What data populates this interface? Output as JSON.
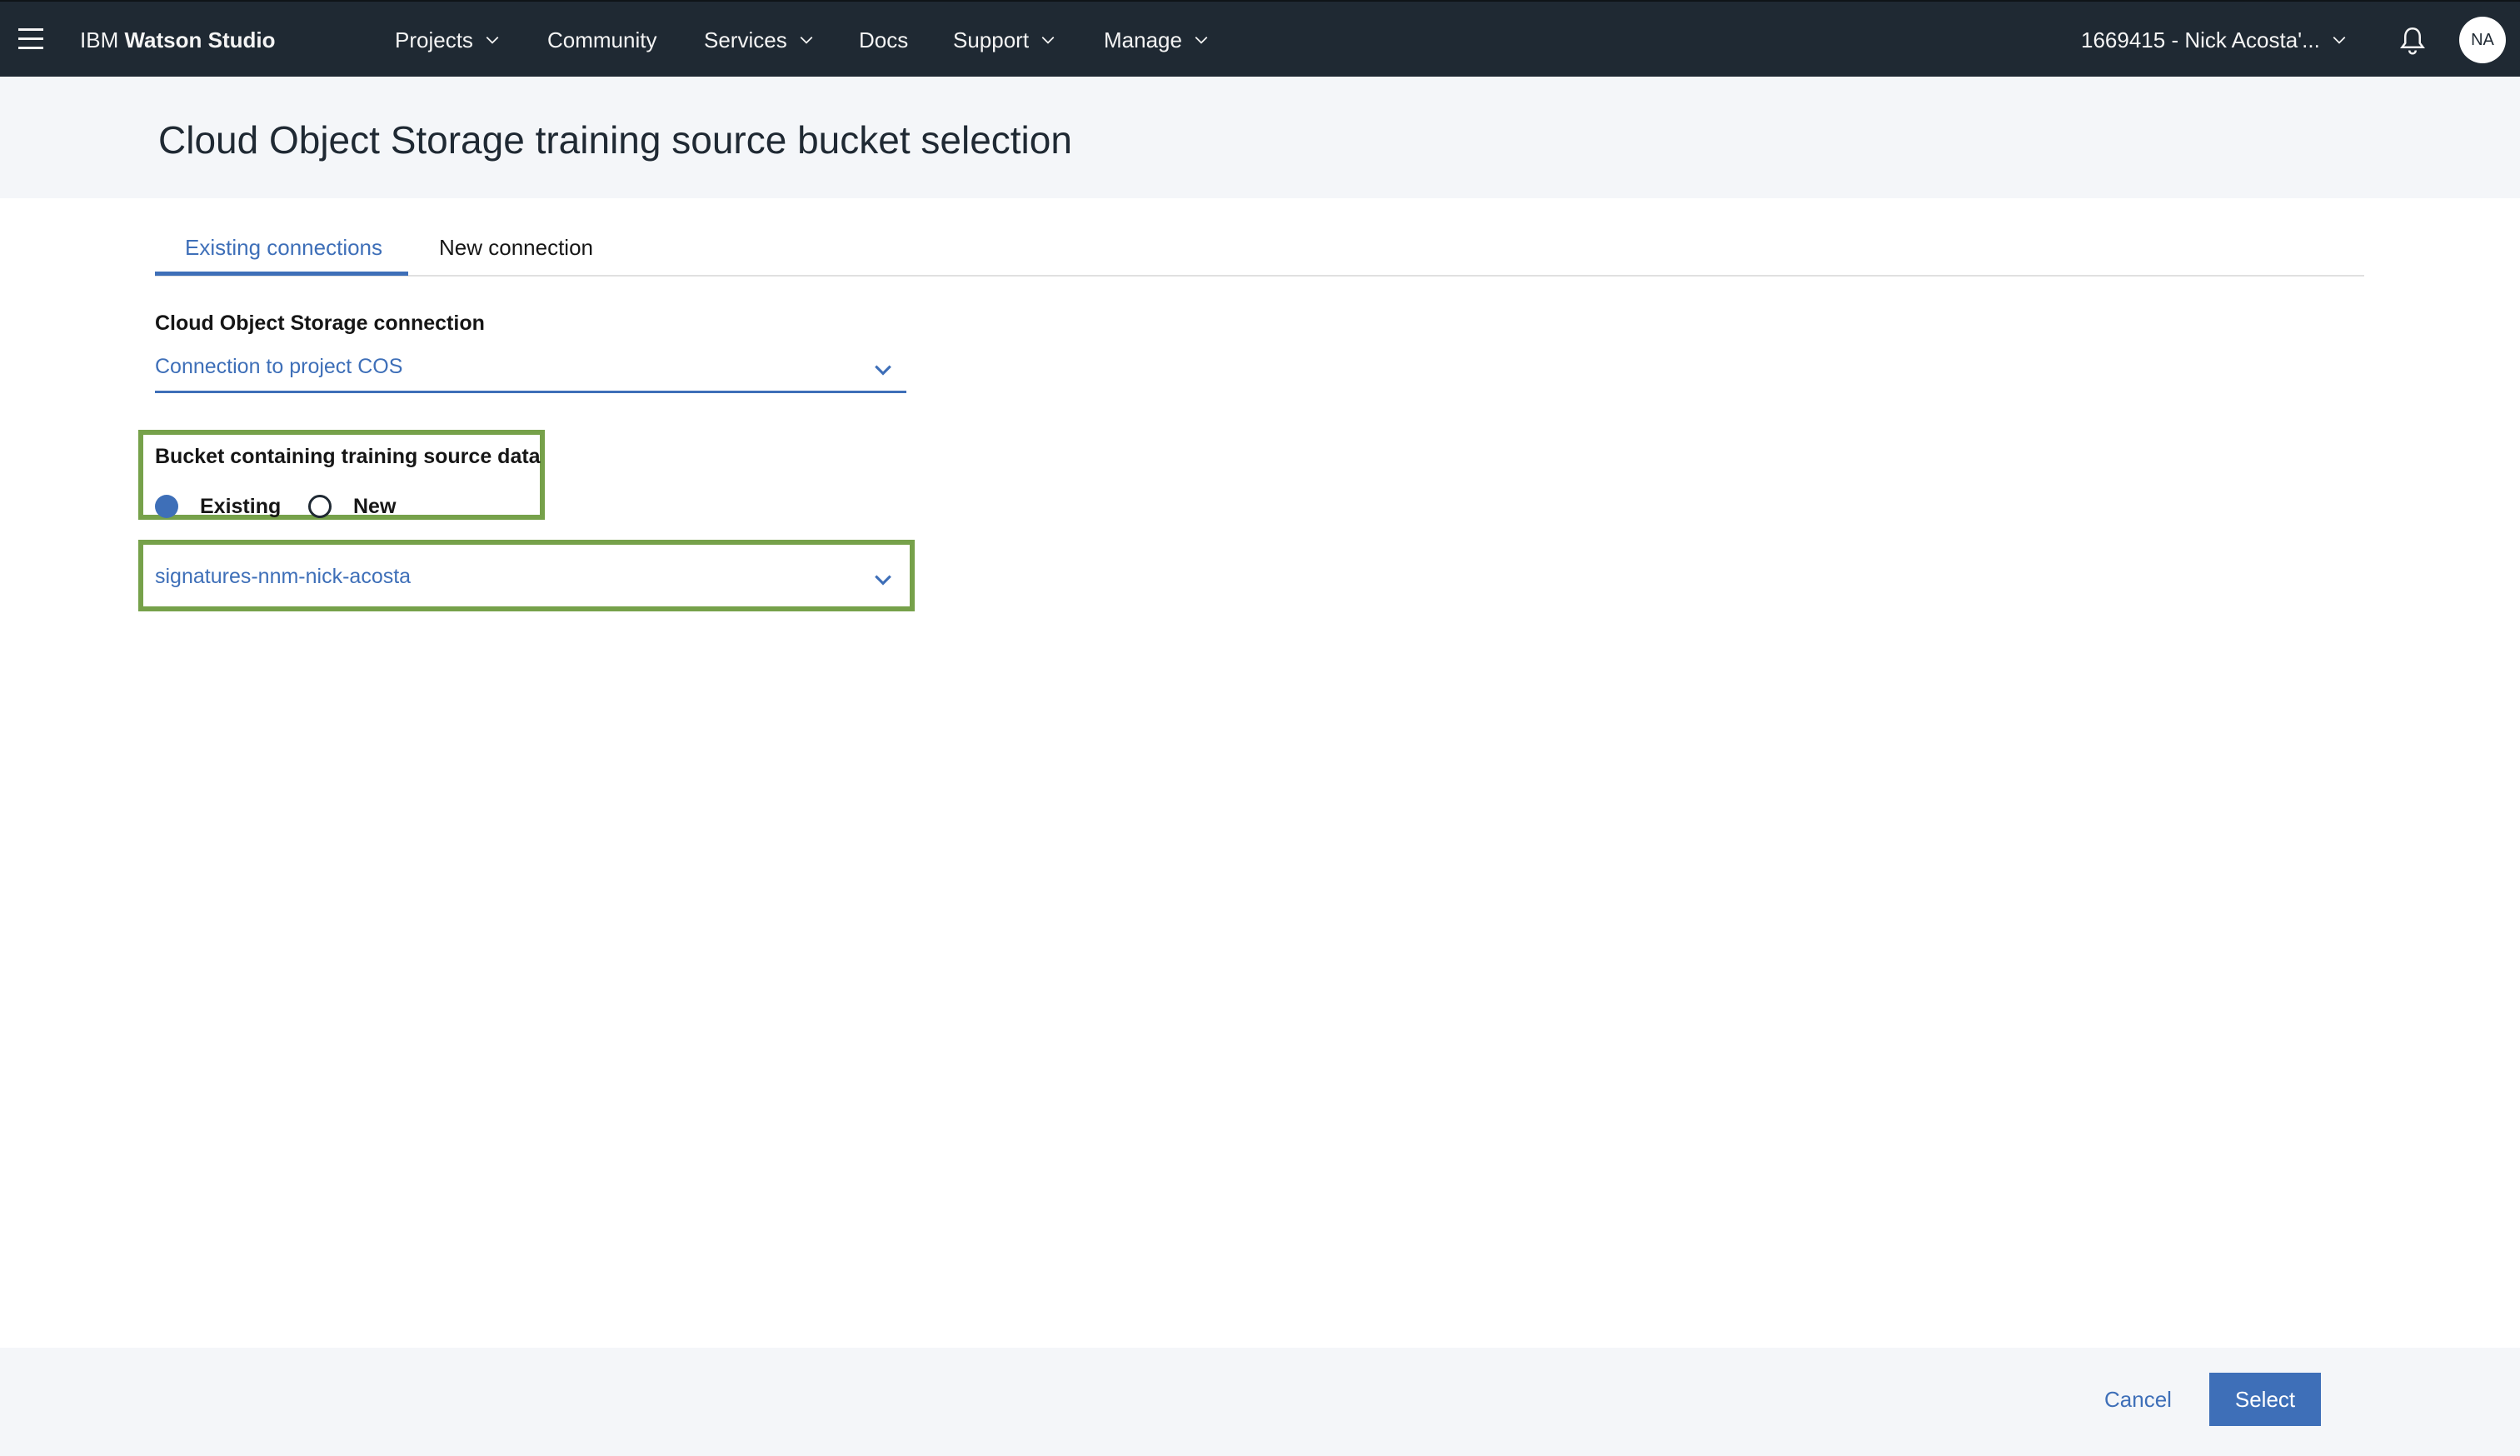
{
  "topbar": {
    "brand_prefix": "IBM",
    "brand_name": "Watson Studio",
    "nav": {
      "projects": "Projects",
      "community": "Community",
      "services": "Services",
      "docs": "Docs",
      "support": "Support",
      "manage": "Manage"
    },
    "account": "1669415 - Nick Acosta'...",
    "avatar_initials": "NA"
  },
  "page": {
    "title": "Cloud Object Storage training source bucket selection"
  },
  "tabs": {
    "existing": "Existing connections",
    "new": "New connection",
    "active": "Existing connections"
  },
  "form": {
    "connection_label": "Cloud Object Storage connection",
    "connection_value": "Connection to project COS",
    "bucket_label": "Bucket containing training source data",
    "bucket_options": {
      "existing": "Existing",
      "new": "New",
      "selected": "Existing"
    },
    "bucket_value": "signatures-nnm-nick-acosta"
  },
  "footer": {
    "cancel_label": "Cancel",
    "select_label": "Select"
  },
  "colors": {
    "accent": "#3e6fb8",
    "highlight": "#76a14a",
    "topbar": "#1f2933"
  },
  "icons": [
    "hamburger-icon",
    "chevron-down-icon",
    "bell-icon"
  ]
}
